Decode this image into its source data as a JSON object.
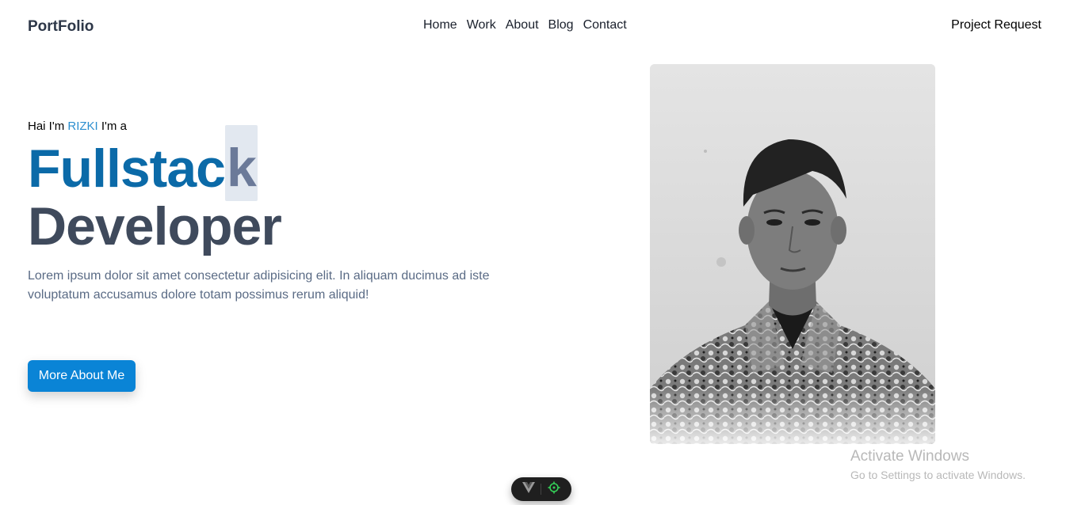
{
  "header": {
    "brand": "PortFolio",
    "nav": [
      "Home",
      "Work",
      "About",
      "Blog",
      "Contact"
    ],
    "project_request": "Project Request"
  },
  "hero": {
    "intro_prefix": "Hai I'm ",
    "intro_name": "RIZKI",
    "intro_suffix": " I'm a",
    "role_line1_main": "Fullstac",
    "role_line1_cursor": "k",
    "role_line2": "Developer",
    "description": "Lorem ipsum dolor sit amet consectetur adipisicing elit. In aliquam ducimus ad iste voluptatum accusamus dolore totam possimus rerum aliquid!",
    "cta_label": "More About Me"
  },
  "watermark": {
    "title": "Activate Windows",
    "subtitle": "Go to Settings to activate Windows."
  },
  "colors": {
    "accent": "#0b6aa8",
    "button": "#0a84d6",
    "name_highlight": "#2b8ecf",
    "heading_dark": "#3f4a5c"
  },
  "icons": {
    "devbar_left": "vue-logo-icon",
    "devbar_right": "inspect-target-icon"
  }
}
